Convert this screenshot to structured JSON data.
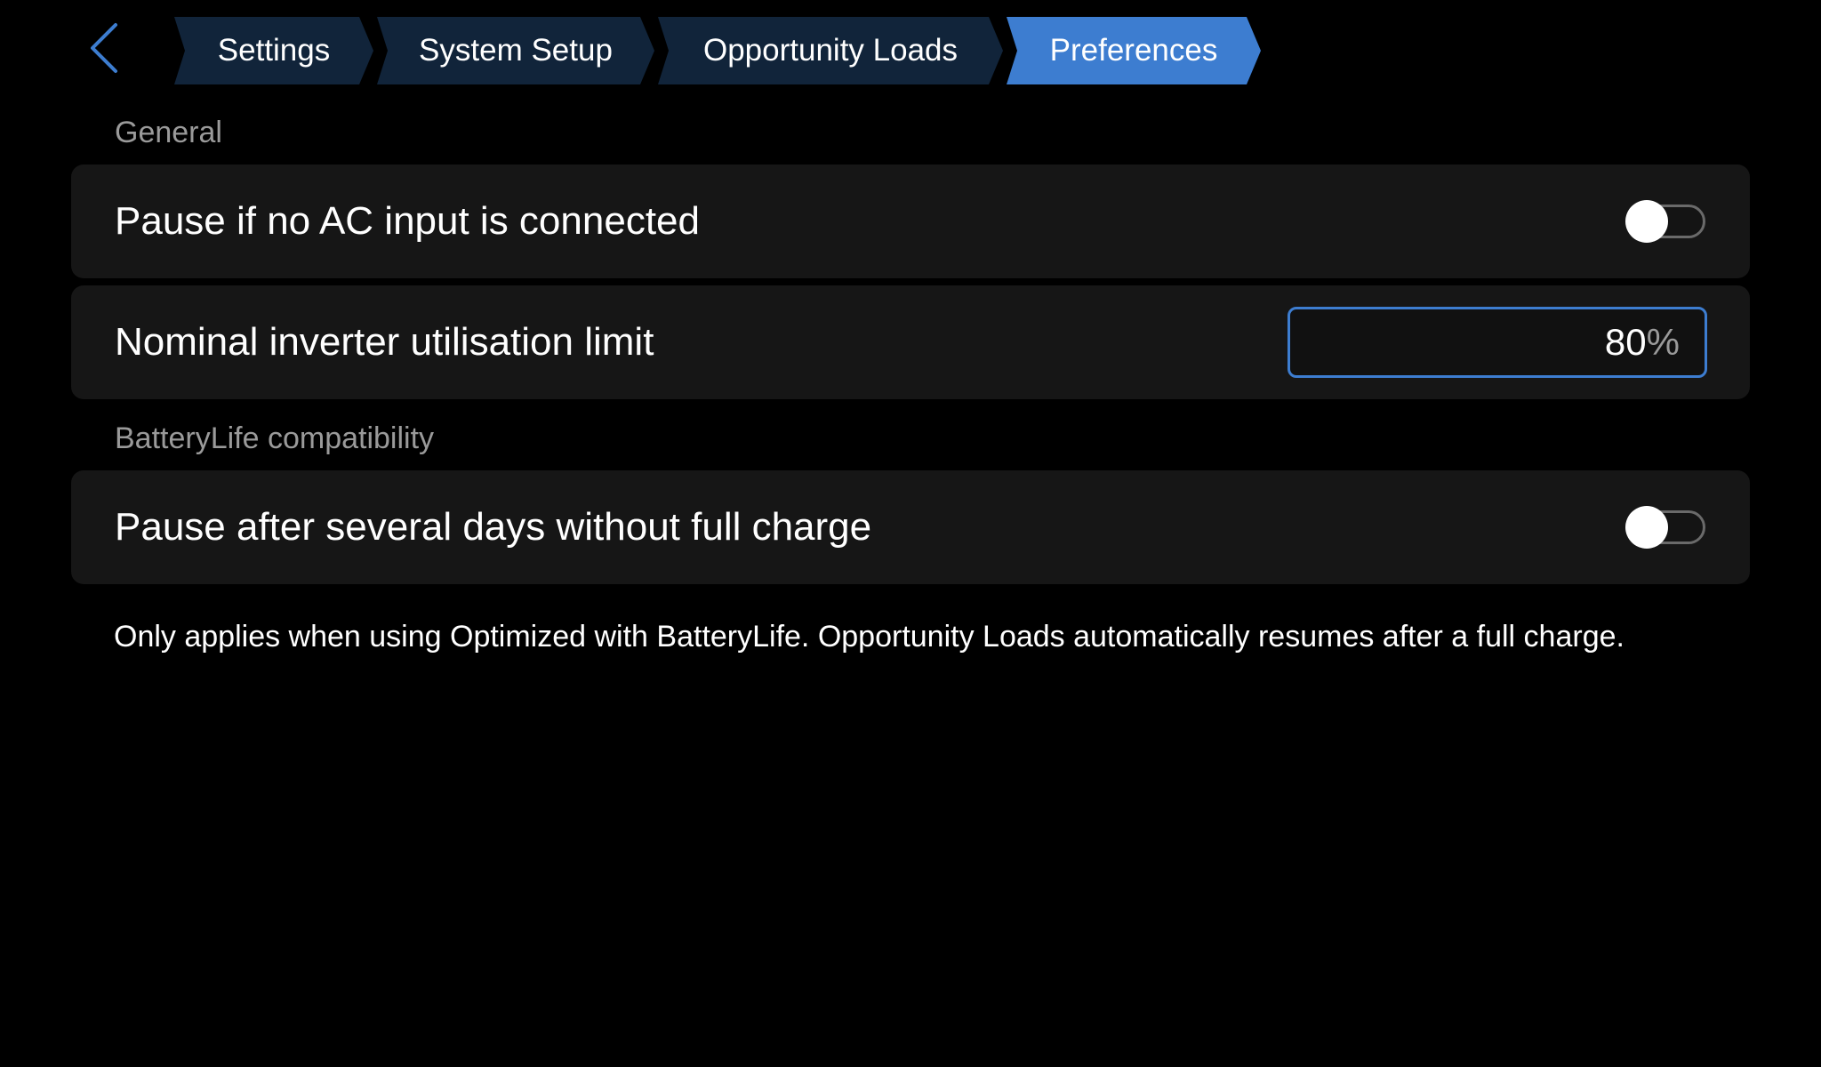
{
  "header": {
    "back_icon": "chevron-left-icon",
    "breadcrumbs": [
      {
        "label": "Settings"
      },
      {
        "label": "System Setup"
      },
      {
        "label": "Opportunity Loads"
      },
      {
        "label": "Preferences",
        "active": true
      }
    ]
  },
  "sections": {
    "general": {
      "title": "General",
      "pause_no_ac": {
        "label": "Pause if no AC input is connected",
        "enabled": false
      },
      "inverter_limit": {
        "label": "Nominal inverter utilisation limit",
        "value": "80",
        "unit": "%"
      }
    },
    "batterylife": {
      "title": "BatteryLife compatibility",
      "pause_no_full_charge": {
        "label": "Pause after several days without full charge",
        "enabled": false
      },
      "help": "Only applies when using Optimized with BatteryLife. Opportunity Loads automatically resumes after a full charge."
    }
  },
  "colors": {
    "accent": "#3d7dd0",
    "crumb_inactive": "#11243a",
    "row_background": "#161616",
    "section_text": "#9a9a9a"
  }
}
